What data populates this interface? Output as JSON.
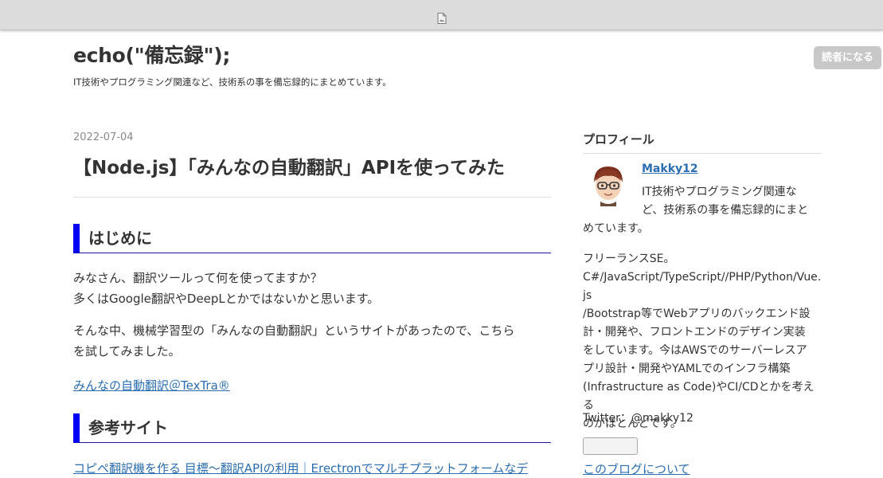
{
  "blog": {
    "title": "echo(\"備忘録\");",
    "description": "IT技術やプログラミング関連など、技術系の事を備忘録的にまとめています。",
    "subscribe_label": "読者になる"
  },
  "entry": {
    "date": "2022-07-04",
    "title": "【Node.js】「みんなの自動翻訳」APIを使ってみた",
    "sections": [
      {
        "heading": "はじめに",
        "paragraphs": [
          [
            "みなさん、翻訳ツールって何を使ってますか？",
            "多くはGoogle翻訳やDeepLとかではないかと思います。"
          ],
          [
            "そんな中、機械学習型の「みんなの自動翻訳」というサイトがあったので、こちら",
            "を試してみました。"
          ]
        ],
        "link": "みんなの自動翻訳＠TexTra®"
      },
      {
        "heading": "参考サイト",
        "link": "コピペ翻訳機を作る 目標〜翻訳APIの利用｜Erectronでマルチプラットフォームなデ"
      }
    ]
  },
  "sidebar": {
    "profile_heading": "プロフィール",
    "profile_name": "Makky12",
    "intro_lines": [
      "IT技術やプログラミング関連な",
      "ど、技術系の事を備忘録的にまと",
      "めています。"
    ],
    "body_lines": [
      "フリーランスSE。",
      "C#/JavaScript/TypeScript//PHP/Python/Vue.js",
      "/Bootstrap等でWebアプリのバックエンド設",
      "計・開発や、フロントエンドのデザイン実装",
      "をしています。今はAWSでのサーバーレスア",
      "プリ設計・開発やYAMLでのインフラ構築",
      "(Infrastructure as Code)やCI/CDとかを考える",
      "のがほとんどです。"
    ],
    "twitter": "Twitter：@makky12",
    "about_link": "このブログについて"
  },
  "colors": {
    "accent_bar": "#0000f2",
    "link": "#2a6db0",
    "subscribe_bg": "#c8c8c8"
  },
  "icons": {
    "topbar": "document-icon",
    "avatar": "avatar-icon"
  }
}
